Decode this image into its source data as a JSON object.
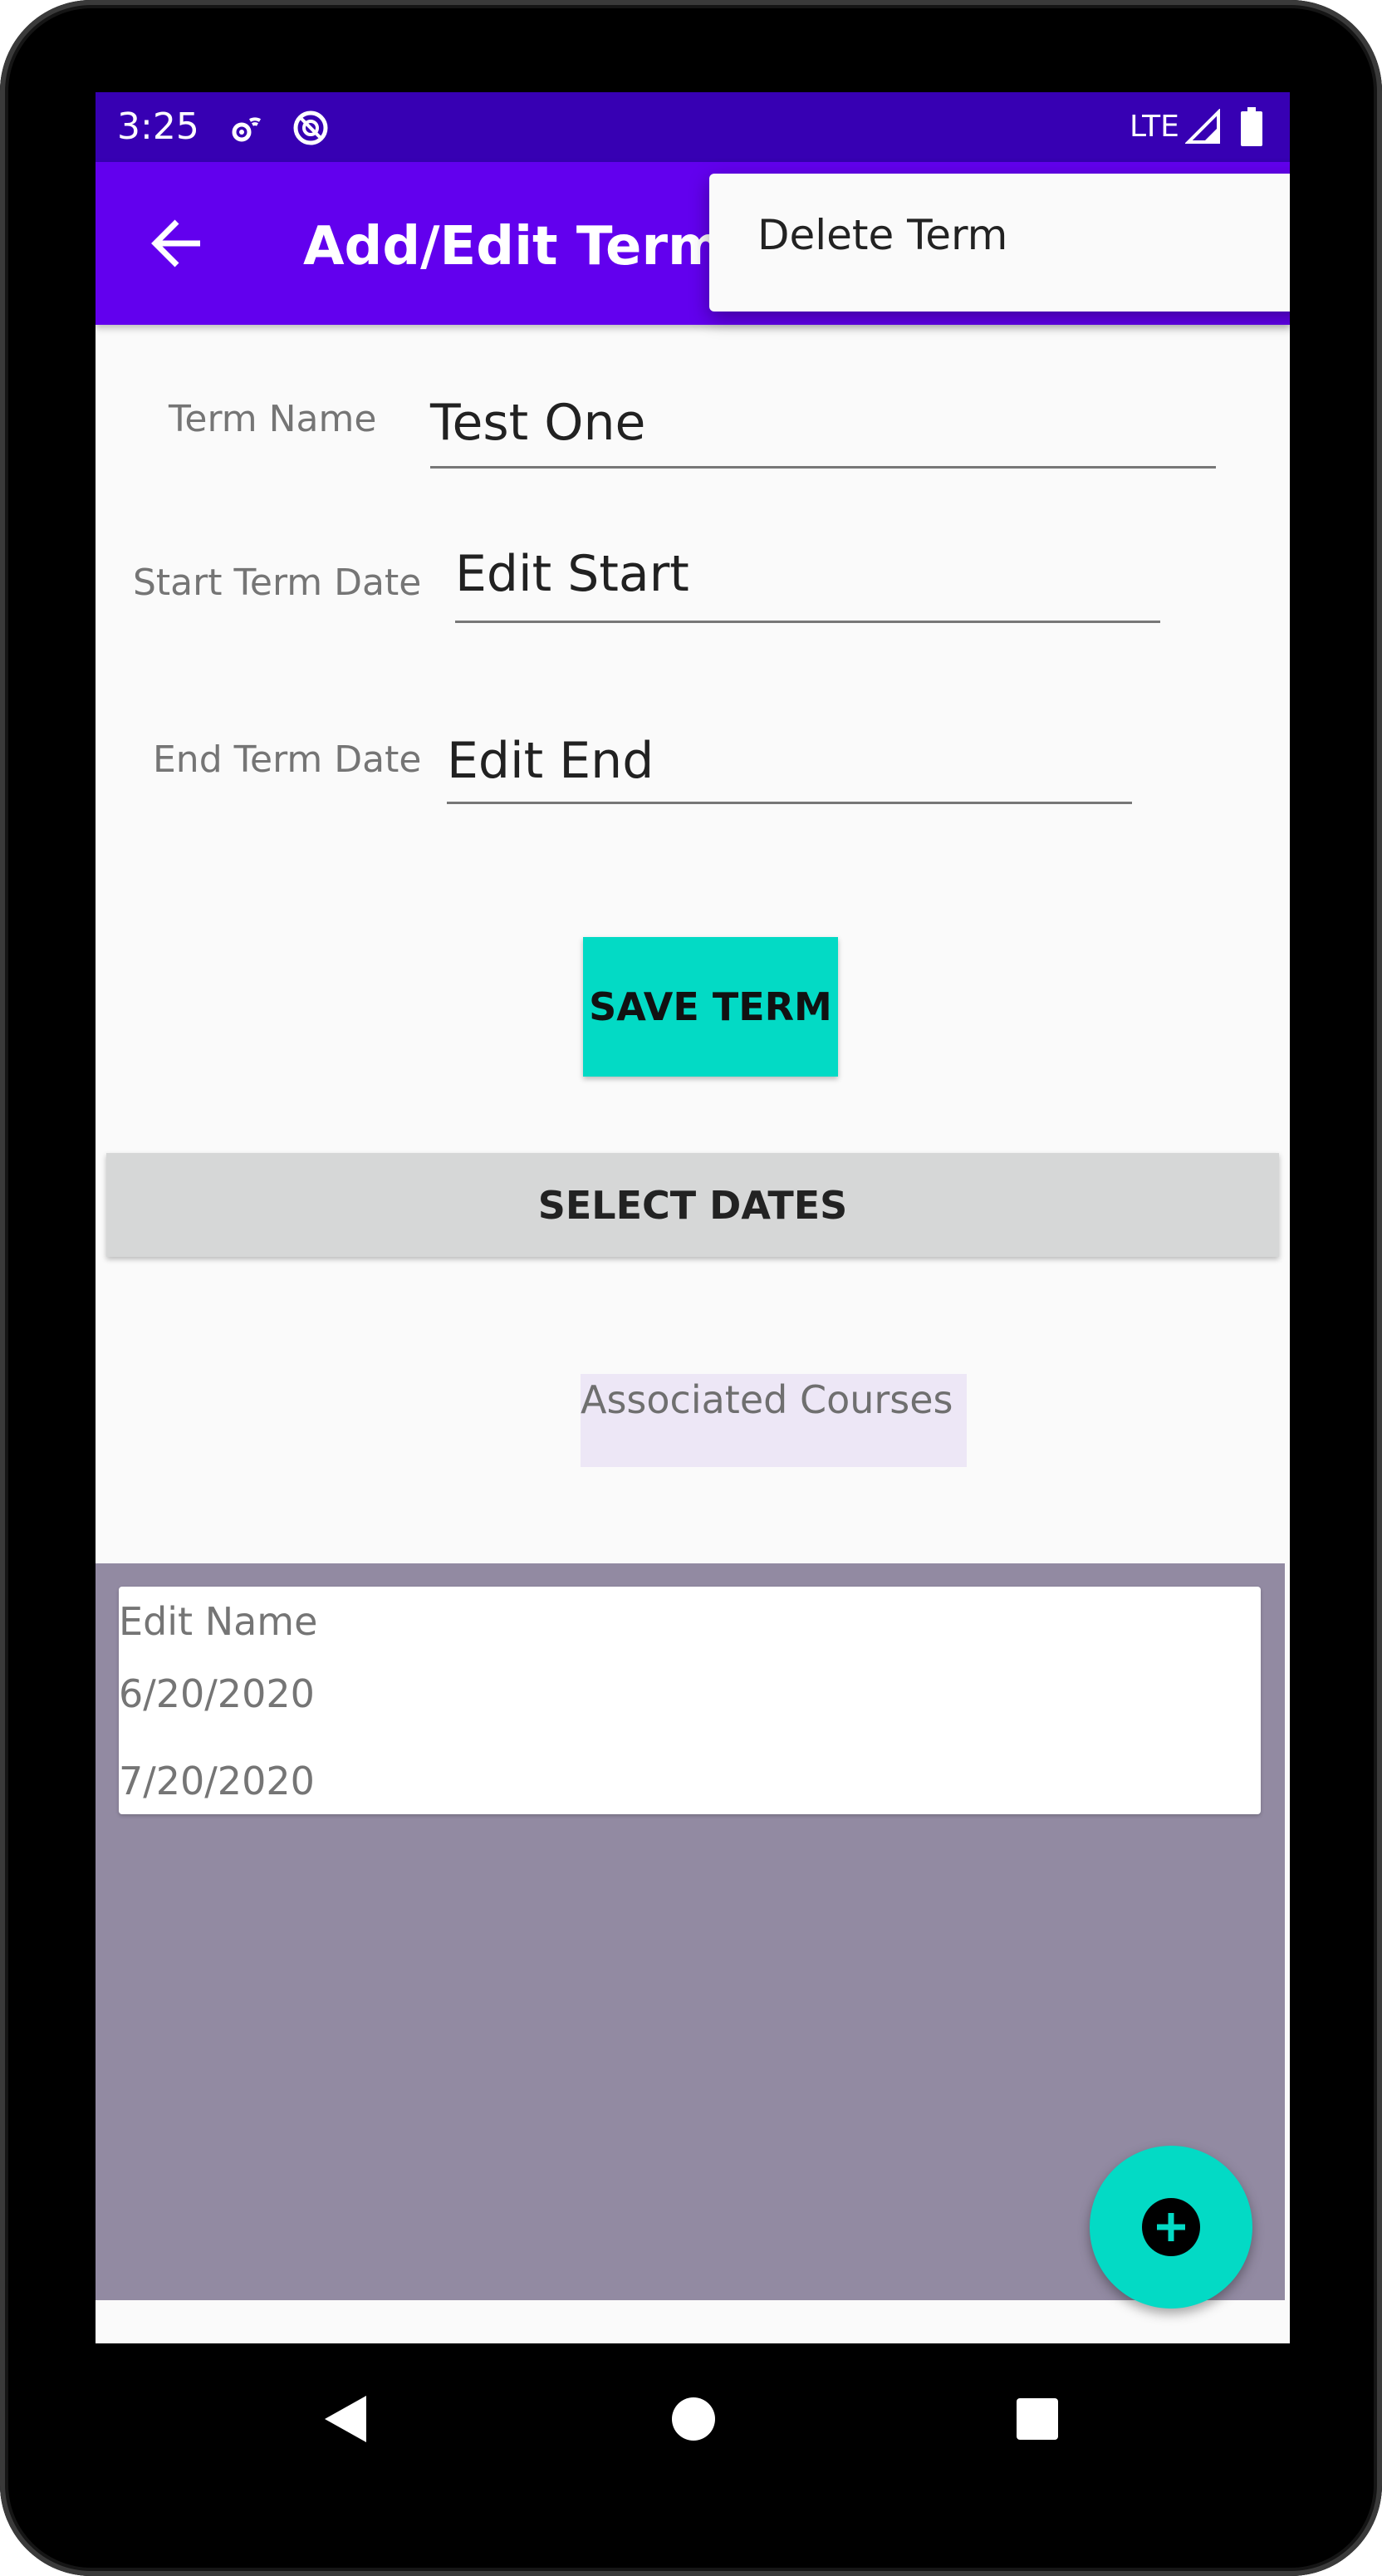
{
  "status_bar": {
    "time": "3:25",
    "network": "LTE",
    "icons": [
      "settings-wifi-icon",
      "no-disturb-icon",
      "signal-icon",
      "battery-icon"
    ]
  },
  "app_bar": {
    "title": "Add/Edit Term D",
    "back_icon": "arrow-back-icon"
  },
  "overflow_menu": {
    "items": [
      {
        "label": "Delete Term"
      }
    ]
  },
  "form": {
    "term_name_label": "Term Name",
    "term_name_value": "Test One",
    "start_label": "Start Term Date",
    "start_value": "Edit Start",
    "end_label": "End Term Date",
    "end_value": "Edit End"
  },
  "buttons": {
    "save": "SAVE TERM",
    "select_dates": "SELECT DATES"
  },
  "associated_courses": {
    "label": "Associated Courses",
    "items": [
      {
        "name": "Edit Name",
        "start": "6/20/2020",
        "end": "7/20/2020"
      }
    ]
  },
  "fab": {
    "icon": "add-icon"
  },
  "nav_bar": {
    "icons": [
      "back-triangle-icon",
      "home-circle-icon",
      "recents-square-icon"
    ]
  },
  "colors": {
    "status_bar": "#3700b3",
    "app_bar": "#6200ee",
    "accent": "#03dac5",
    "courses_bg": "#928aa2",
    "background": "#fafafa"
  }
}
